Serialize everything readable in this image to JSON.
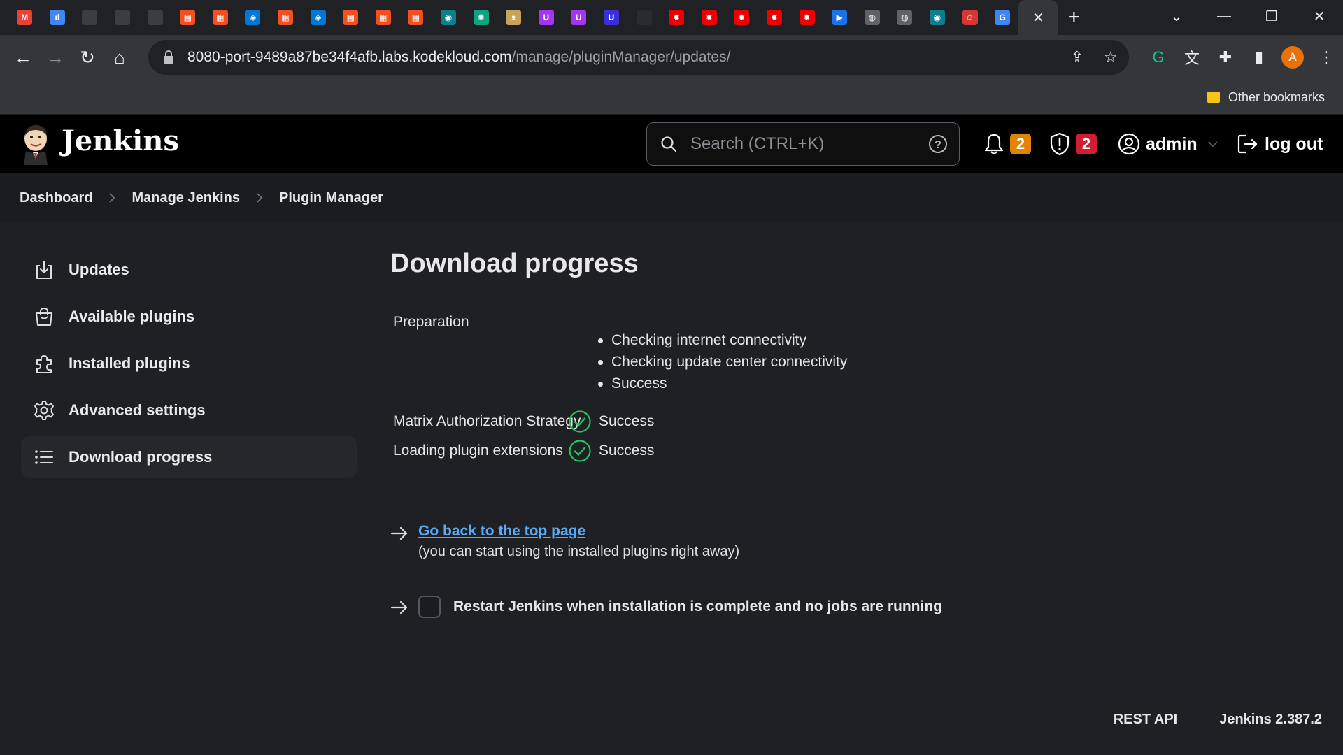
{
  "browser": {
    "tabs": [
      {
        "icon": "gmail-icon",
        "color": "#ea4335",
        "glyph": "M"
      },
      {
        "icon": "analytics-icon",
        "color": "#4285f4",
        "glyph": "ıl"
      },
      {
        "icon": "blank-icon",
        "color": "#3c3d41",
        "glyph": ""
      },
      {
        "icon": "blank-icon",
        "color": "#3c3d41",
        "glyph": ""
      },
      {
        "icon": "blank-icon",
        "color": "#3c3d41",
        "glyph": ""
      },
      {
        "icon": "microsoft-icon",
        "color": "#f25022",
        "glyph": "▦"
      },
      {
        "icon": "microsoft-icon",
        "color": "#f25022",
        "glyph": "▦"
      },
      {
        "icon": "azure-devops-icon",
        "color": "#0078d4",
        "glyph": "◈"
      },
      {
        "icon": "microsoft-icon",
        "color": "#f25022",
        "glyph": "▦"
      },
      {
        "icon": "azure-devops-icon",
        "color": "#0078d4",
        "glyph": "◈"
      },
      {
        "icon": "microsoft-icon",
        "color": "#f25022",
        "glyph": "▦"
      },
      {
        "icon": "microsoft-icon",
        "color": "#f25022",
        "glyph": "▦"
      },
      {
        "icon": "microsoft-icon",
        "color": "#f25022",
        "glyph": "▦"
      },
      {
        "icon": "eye-icon",
        "color": "#0d7f8c",
        "glyph": "◉"
      },
      {
        "icon": "openai-icon",
        "color": "#10a37f",
        "glyph": "✺"
      },
      {
        "icon": "cat-icon",
        "color": "#c9a35a",
        "glyph": "ᴥ"
      },
      {
        "icon": "udemy-icon",
        "color": "#a435f0",
        "glyph": "U"
      },
      {
        "icon": "udemy-icon",
        "color": "#a435f0",
        "glyph": "U"
      },
      {
        "icon": "u-icon",
        "color": "#3b2fd9",
        "glyph": "U"
      },
      {
        "icon": "blank-icon",
        "color": "#2a2b2f",
        "glyph": ""
      },
      {
        "icon": "redhat-icon",
        "color": "#ee0000",
        "glyph": "✹"
      },
      {
        "icon": "redhat-icon",
        "color": "#ee0000",
        "glyph": "✹"
      },
      {
        "icon": "redhat-icon",
        "color": "#ee0000",
        "glyph": "✹"
      },
      {
        "icon": "redhat-icon",
        "color": "#ee0000",
        "glyph": "✹"
      },
      {
        "icon": "redhat-icon",
        "color": "#ee0000",
        "glyph": "✹"
      },
      {
        "icon": "play-icon",
        "color": "#1a73e8",
        "glyph": "▶"
      },
      {
        "icon": "globe-icon",
        "color": "#5f6368",
        "glyph": "◍"
      },
      {
        "icon": "globe-icon",
        "color": "#5f6368",
        "glyph": "◍"
      },
      {
        "icon": "eye-icon",
        "color": "#0d7f8c",
        "glyph": "◉"
      },
      {
        "icon": "jenkins-icon",
        "color": "#d33833",
        "glyph": "☺"
      },
      {
        "icon": "google-icon",
        "color": "#4285f4",
        "glyph": "G"
      }
    ],
    "url_host": "8080-port-9489a87be34f4afb.labs.kodekloud.com",
    "url_path": "/manage/pluginManager/updates/",
    "profile_initial": "A",
    "other_bookmarks": "Other bookmarks"
  },
  "jenkins": {
    "brand": "Jenkins",
    "search_placeholder": "Search (CTRL+K)",
    "notifications_count": "2",
    "security_count": "2",
    "user": "admin",
    "logout": "log out",
    "colors": {
      "notify_badge": "#e38400",
      "security_badge": "#d11e33",
      "link": "#5aa9f5",
      "success": "#22c55e"
    }
  },
  "breadcrumbs": [
    "Dashboard",
    "Manage Jenkins",
    "Plugin Manager"
  ],
  "sidebar": {
    "items": [
      {
        "label": "Updates",
        "icon": "download-icon"
      },
      {
        "label": "Available plugins",
        "icon": "shopping-bag-icon"
      },
      {
        "label": "Installed plugins",
        "icon": "puzzle-icon"
      },
      {
        "label": "Advanced settings",
        "icon": "gear-icon"
      },
      {
        "label": "Download progress",
        "icon": "list-icon",
        "active": true
      }
    ]
  },
  "main": {
    "title": "Download progress",
    "preparation_label": "Preparation",
    "preparation_steps": [
      "Checking internet connectivity",
      "Checking update center connectivity",
      "Success"
    ],
    "plugins": [
      {
        "name": "Matrix Authorization Strategy",
        "status": "Success"
      },
      {
        "name": "Loading plugin extensions",
        "status": "Success"
      }
    ],
    "top_link": "Go back to the top page",
    "top_link_sub": "(you can start using the installed plugins right away)",
    "restart_label": "Restart Jenkins when installation is complete and no jobs are running"
  },
  "footer": {
    "rest_api": "REST API",
    "version": "Jenkins 2.387.2"
  }
}
